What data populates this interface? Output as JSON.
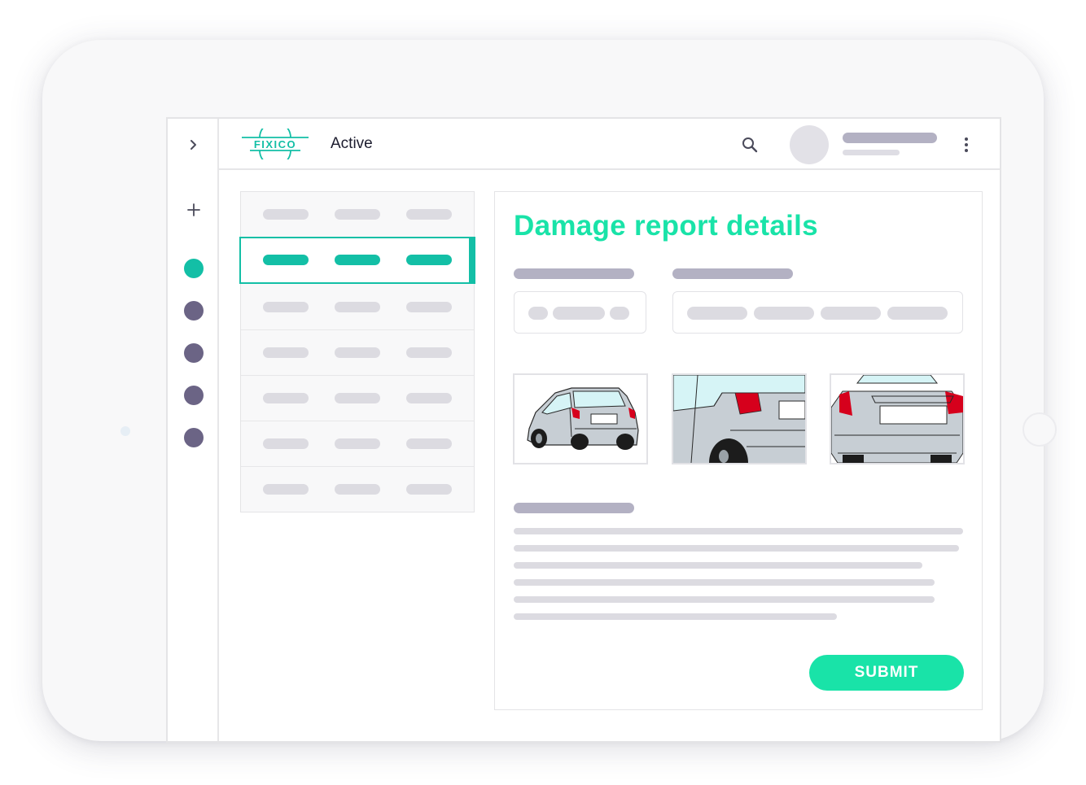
{
  "brand": {
    "logo_text": "FIXICO",
    "accent_color": "#13bfa6",
    "title_color": "#19e3a8"
  },
  "header": {
    "status_label": "Active",
    "search_icon": "search-icon",
    "more_icon": "more-vertical-icon"
  },
  "sidebar": {
    "expand_icon": "chevron-right-icon",
    "add_icon": "plus-icon",
    "nav_items": [
      {
        "color": "#13bfa6",
        "active": true
      },
      {
        "color": "#6b6485",
        "active": false
      },
      {
        "color": "#6b6485",
        "active": false
      },
      {
        "color": "#6b6485",
        "active": false
      },
      {
        "color": "#6b6485",
        "active": false
      }
    ]
  },
  "detail": {
    "title": "Damage report details",
    "submit_label": "SUBMIT",
    "photos": [
      "car-rear-three-quarter",
      "car-rear-left-closeup",
      "car-rear-bumper-closeup"
    ]
  }
}
